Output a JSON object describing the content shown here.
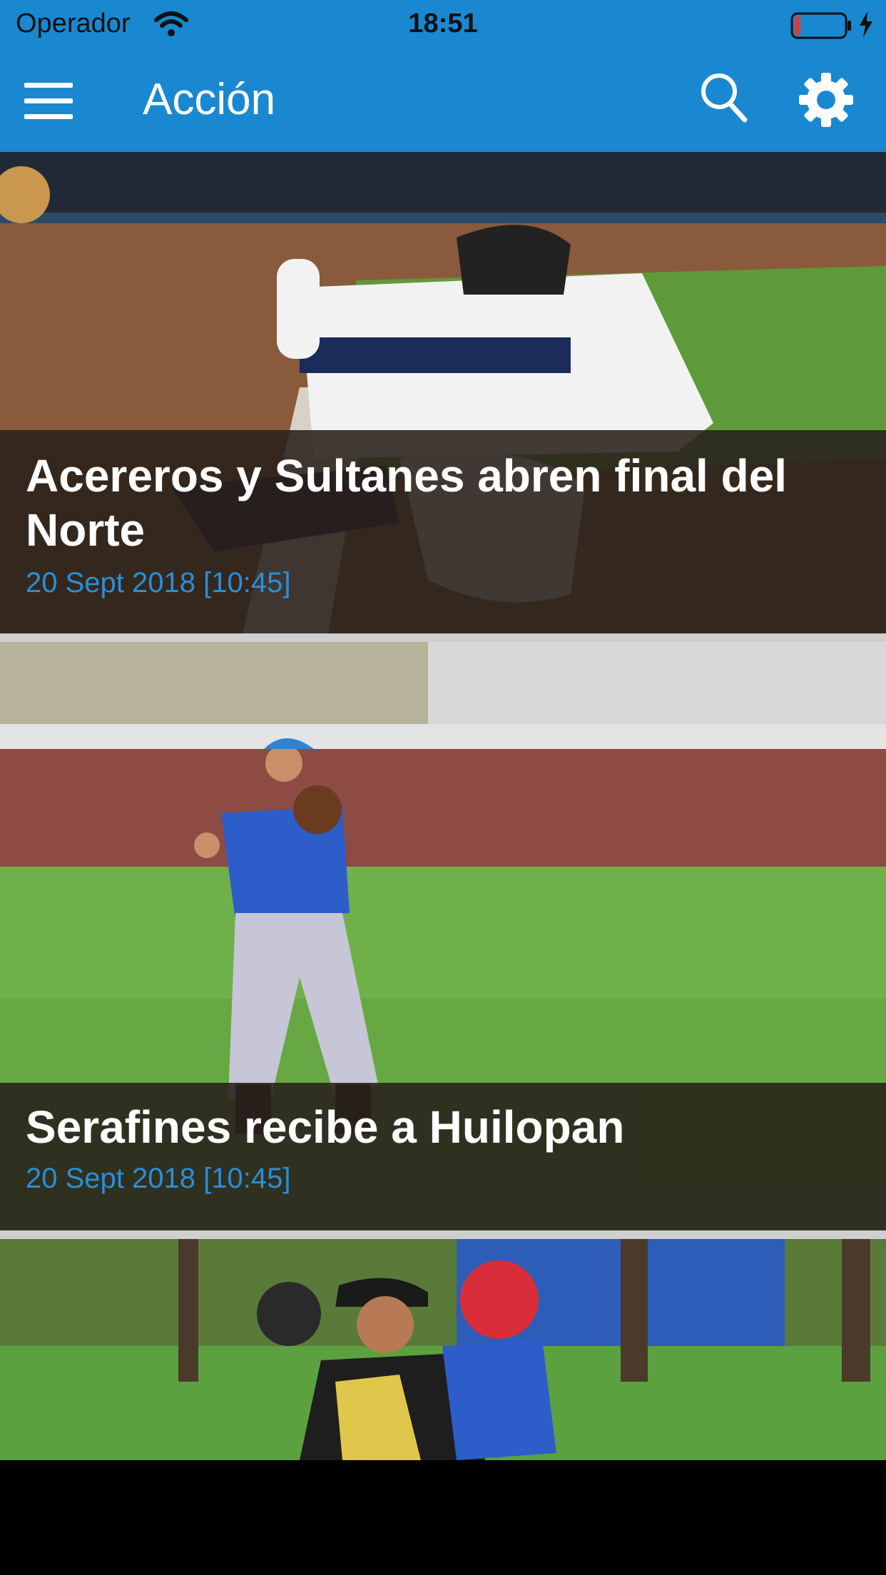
{
  "status_bar": {
    "carrier": "Operador",
    "time": "18:51",
    "battery_color": "#e53935"
  },
  "nav": {
    "title": "Acción",
    "menu_icon": "hamburger-menu-icon",
    "search_icon": "search-icon",
    "settings_icon": "gear-icon",
    "bar_color": "#1a88d0"
  },
  "articles": [
    {
      "title": "Acereros y Sultanes abren final del Norte",
      "date": "20 Sept 2018 [10:45]",
      "photo": "baseball-player-sliding-photo"
    },
    {
      "title": "Serafines recibe a Huilopan",
      "date": "20 Sept 2018 [10:45]",
      "photo": "youth-player-throwing-photo"
    },
    {
      "title": "",
      "date": "",
      "photo": "youth-players-fielding-photo"
    }
  ],
  "colors": {
    "date_text": "#2a8fd8",
    "caption_bg": "rgba(40,32,26,0.88)"
  }
}
